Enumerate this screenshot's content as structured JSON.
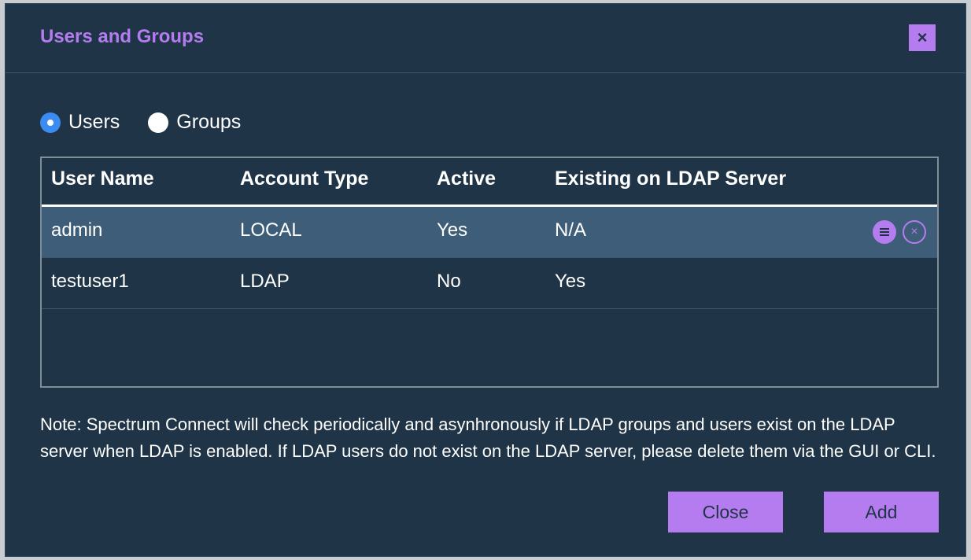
{
  "dialog": {
    "title": "Users and Groups",
    "close_glyph": "×"
  },
  "view_toggle": {
    "options": [
      {
        "label": "Users",
        "selected": true
      },
      {
        "label": "Groups",
        "selected": false
      }
    ]
  },
  "table": {
    "columns": [
      "User Name",
      "Account Type",
      "Active",
      "Existing on LDAP Server"
    ],
    "rows": [
      {
        "user_name": "admin",
        "account_type": "LOCAL",
        "active": "Yes",
        "existing_on_ldap": "N/A",
        "highlighted": true,
        "actions": [
          "menu-icon",
          "delete-icon"
        ]
      },
      {
        "user_name": "testuser1",
        "account_type": "LDAP",
        "active": "No",
        "existing_on_ldap": "Yes",
        "highlighted": false
      }
    ],
    "delete_glyph": "×"
  },
  "note": "Note: Spectrum Connect will check periodically and asynhronously if LDAP groups and users exist on the LDAP server when LDAP is enabled. If LDAP users do not exist on the LDAP server, please delete them via the GUI or CLI.",
  "buttons": {
    "close": "Close",
    "add": "Add"
  },
  "colors": {
    "accent": "#b57cf0",
    "background": "#1f3446",
    "selected_row": "#3e5d78",
    "radio_selected": "#3b8bf0"
  }
}
